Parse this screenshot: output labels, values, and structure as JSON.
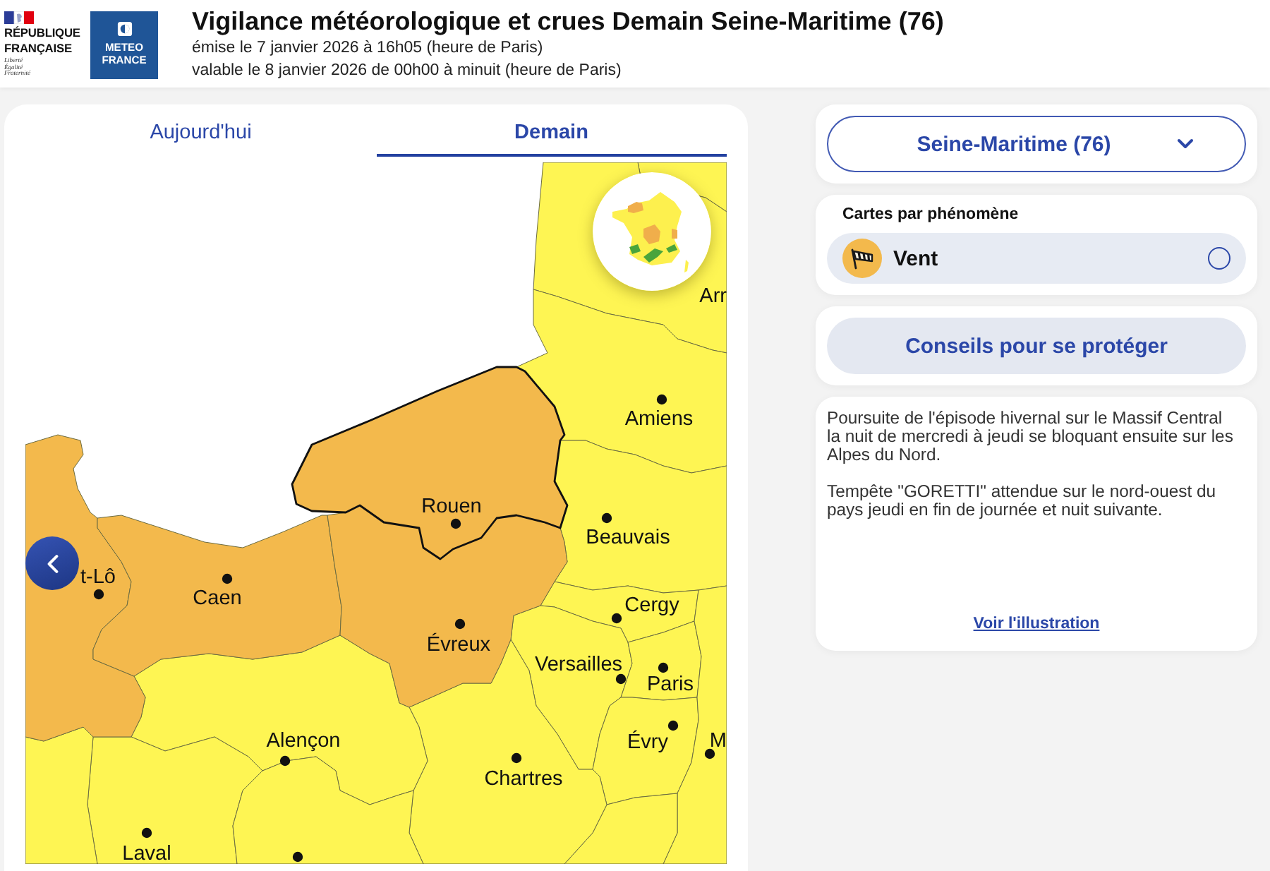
{
  "header": {
    "rf_logo": {
      "name": "RÉPUBLIQUE FRANÇAISE",
      "motto": "Liberté Égalité Fraternité"
    },
    "mf_logo": {
      "name": "METEO FRANCE"
    },
    "title": "Vigilance météorologique et crues Demain Seine-Maritime (76)",
    "issued": "émise le 7 janvier 2026 à 16h05 (heure de Paris)",
    "valid": "valable le 8 janvier 2026 de 00h00 à minuit (heure de Paris)"
  },
  "tabs": [
    {
      "label": "Aujourd'hui",
      "selected": false
    },
    {
      "label": "Demain",
      "selected": true
    }
  ],
  "map": {
    "departments": [
      {
        "color": "#fef553",
        "selected": false
      },
      {
        "color": "#fef553",
        "selected": false
      },
      {
        "color": "#fef553",
        "selected": false
      },
      {
        "color": "#fef553",
        "selected": false
      },
      {
        "color": "#fef553",
        "selected": false
      },
      {
        "color": "#fef553",
        "selected": false
      },
      {
        "color": "#fef553",
        "selected": false
      },
      {
        "color": "#fef553",
        "selected": false
      },
      {
        "color": "#fef553",
        "selected": false
      },
      {
        "color": "#fef553",
        "selected": false
      },
      {
        "color": "#fef553",
        "selected": false
      },
      {
        "color": "#fef553",
        "selected": false
      },
      {
        "color": "#fef553",
        "selected": false
      },
      {
        "color": "#fef553",
        "selected": false
      },
      {
        "color": "#fef553",
        "selected": false
      },
      {
        "color": "#f3b94c",
        "selected": false
      },
      {
        "color": "#f3b94c",
        "selected": false
      },
      {
        "color": "#f3b94c",
        "selected": false
      },
      {
        "color": "#f3b94c",
        "selected": true
      }
    ],
    "cities": [
      {
        "name": "Arr"
      },
      {
        "name": "Amiens"
      },
      {
        "name": "Rouen"
      },
      {
        "name": "Beauvais"
      },
      {
        "name": "t-Lô"
      },
      {
        "name": "Caen"
      },
      {
        "name": "Cergy"
      },
      {
        "name": "Évreux"
      },
      {
        "name": "Versailles"
      },
      {
        "name": "Paris"
      },
      {
        "name": "Alençon"
      },
      {
        "name": "Évry"
      },
      {
        "name": "M"
      },
      {
        "name": "Chartres"
      },
      {
        "name": "Laval"
      }
    ]
  },
  "department_select": {
    "value": "Seine-Maritime (76)"
  },
  "phenomena": {
    "title": "Cartes par phénomène",
    "items": [
      {
        "label": "Vent",
        "selected": false
      }
    ]
  },
  "advice_button": "Conseils pour se protéger",
  "bulletin": {
    "paragraphs": [
      "Poursuite de l'épisode hivernal sur le Massif Central la nuit de mercredi à jeudi se bloquant ensuite sur les Alpes du Nord.",
      "Tempête \"GORETTI\" attendue sur le nord-ouest du pays jeudi en fin de journée et nuit suivante."
    ],
    "link": "Voir l'illustration"
  }
}
